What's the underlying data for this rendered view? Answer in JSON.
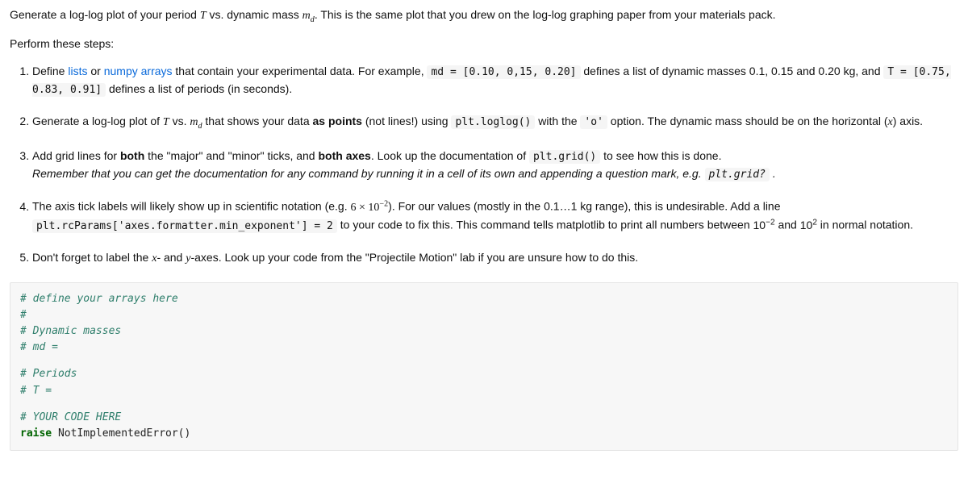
{
  "intro": {
    "line1_a": "Generate a log-log plot of your period ",
    "line1_T": "T",
    "line1_b": " vs. dynamic mass ",
    "line1_m": "m",
    "line1_d": "d",
    "line1_c": ". This is the same plot that you drew on the log-log graphing paper from your materials pack.",
    "line2": "Perform these steps:"
  },
  "s1": {
    "a": "Define ",
    "link_lists": "lists",
    "or": " or ",
    "link_numpy": "numpy arrays",
    "b": " that contain your experimental data. For example, ",
    "code_md": "md = [0.10, 0,15, 0.20]",
    "c": " defines a list of dynamic masses 0.1, 0.15 and 0.20 kg, and ",
    "code_T": "T = [0.75, 0.83, 0.91]",
    "d": " defines a list of periods (in seconds)."
  },
  "s2": {
    "a": "Generate a log-log plot of ",
    "T": "T",
    "b": " vs. ",
    "m": "m",
    "dsub": "d",
    "c": " that shows your data ",
    "bold1": "as points",
    "d": " (not lines!) using ",
    "code_loglog": "plt.loglog()",
    "e": " with the ",
    "code_o": "'o'",
    "f": " option. The dynamic mass should be on the horizontal (",
    "x": "x",
    "g": ") axis."
  },
  "s3": {
    "a": "Add grid lines for ",
    "bold_both1": "both",
    "b": " the \"major\" and \"minor\" ticks, and ",
    "bold_both2": "both axes",
    "c": ". Look up the documentation of ",
    "code_grid": "plt.grid()",
    "d": " to see how this is done.",
    "hint_a": "Remember that you can get the documentation for any command by running it in a cell of its own and appending a question mark, e.g. ",
    "hint_code": "plt.grid?",
    "hint_b": " ."
  },
  "s4": {
    "a": "The axis tick labels will likely show up in scientific notation (e.g. ",
    "sci_base": "6 × 10",
    "sci_exp": "−2",
    "b": "). For our values (mostly in the 0.1…1 kg range), this is undesirable. Add a line ",
    "code_rc": "plt.rcParams['axes.formatter.min_exponent'] = 2",
    "c": " to your code to fix this. This command tells matplotlib to print all numbers between ",
    "lo_base": "10",
    "lo_exp": "−2",
    "and": " and ",
    "hi_base": "10",
    "hi_exp": "2",
    "d": " in normal notation."
  },
  "s5": {
    "a": "Don't forget to label the ",
    "x": "x",
    "dashand": "- and ",
    "y": "y",
    "b": "-axes. Look up your code from the \"Projectile Motion\" lab if you are unsure how to do this."
  },
  "code": {
    "l1": "# define your arrays here",
    "l2": "#",
    "l3": "# Dynamic masses",
    "l4": "# md =",
    "l5": "# Periods",
    "l6": "# T =",
    "l7": "# YOUR CODE HERE",
    "kw": "raise",
    "l8b": " NotImplementedError()"
  }
}
